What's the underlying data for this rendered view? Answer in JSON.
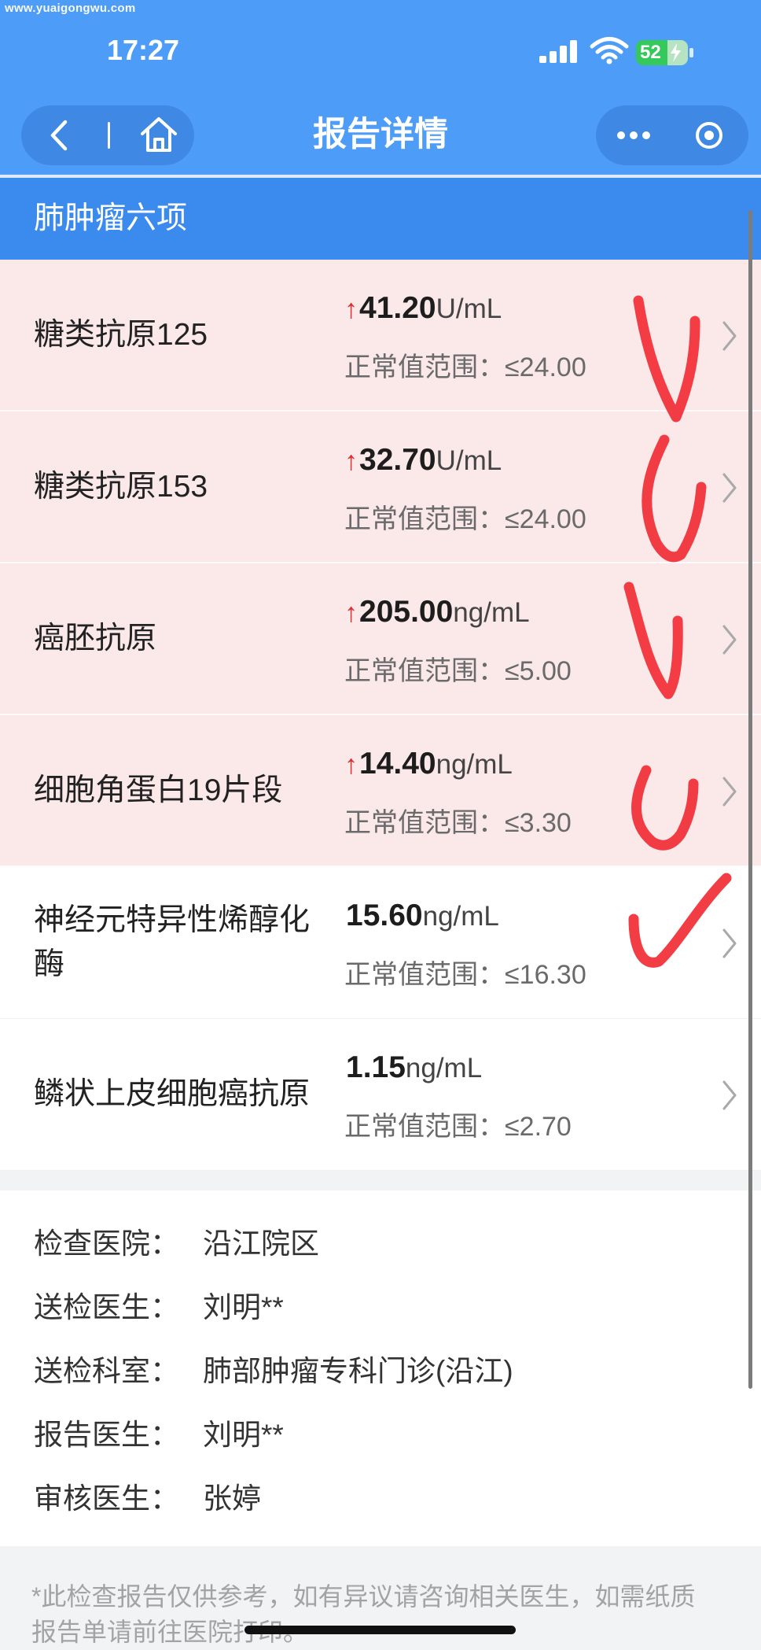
{
  "watermark": "www.yuaigongwu.com",
  "status_bar": {
    "time": "17:27",
    "battery_level": "52",
    "icons": [
      "signal-icon",
      "wifi-icon",
      "battery-charging-icon"
    ]
  },
  "nav": {
    "title": "报告详情",
    "left_icons": [
      "chevron-left-icon",
      "home-icon"
    ],
    "right_icons": [
      "more-dots-icon",
      "target-close-icon"
    ]
  },
  "report": {
    "section_title": "肺肿瘤六项",
    "items": [
      {
        "name": "糖类抗原125",
        "flag": "↑",
        "value": "41.20",
        "unit": "U/mL",
        "range": "正常值范围：≤24.00",
        "abnormal": true
      },
      {
        "name": "糖类抗原153",
        "flag": "↑",
        "value": "32.70",
        "unit": "U/mL",
        "range": "正常值范围：≤24.00",
        "abnormal": true
      },
      {
        "name": "癌胚抗原",
        "flag": "↑",
        "value": "205.00",
        "unit": "ng/mL",
        "range": "正常值范围：≤5.00",
        "abnormal": true
      },
      {
        "name": "细胞角蛋白19片段",
        "flag": "↑",
        "value": "14.40",
        "unit": "ng/mL",
        "range": "正常值范围：≤3.30",
        "abnormal": true
      },
      {
        "name": "神经元特异性烯醇化酶",
        "value": "15.60",
        "unit": "ng/mL",
        "range": "正常值范围：≤16.30",
        "abnormal": false
      },
      {
        "name": "鳞状上皮细胞癌抗原",
        "value": "1.15",
        "unit": "ng/mL",
        "range": "正常值范围：≤2.70",
        "abnormal": false
      }
    ]
  },
  "info": [
    {
      "label": "检查医院：",
      "value": "沿江院区"
    },
    {
      "label": "送检医生：",
      "value": "刘明**"
    },
    {
      "label": "送检科室：",
      "value": "肺部肿瘤专科门诊(沿江)"
    },
    {
      "label": "报告医生：",
      "value": "刘明**"
    },
    {
      "label": "审核医生：",
      "value": "张婷"
    }
  ],
  "footnote": "*此检查报告仅供参考，如有异议请咨询相关医生，如需纸质报告单请前往医院打印。",
  "handwritten_marks": [
    "arrow-down-mark",
    "arrow-down-mark",
    "arrow-down-mark",
    "arrow-down-mark",
    "checkmark-mark"
  ],
  "colors": {
    "nav_blue": "#4d9cf8",
    "section_blue": "#3b8aee",
    "abnormal_row_bg": "#fbe8e9",
    "high_flag": "#e02b2b",
    "mark_red": "#f2333b",
    "battery_green": "#35c85a"
  }
}
